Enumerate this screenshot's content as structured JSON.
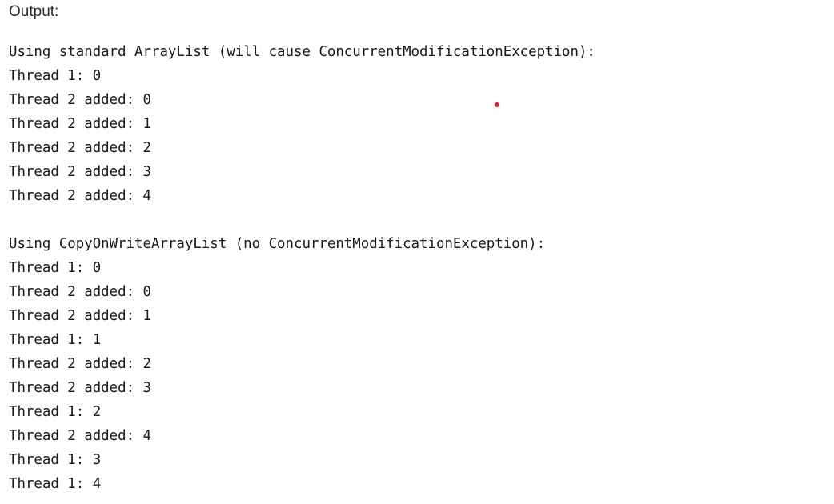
{
  "heading": "Output:",
  "lines": [
    "Using standard ArrayList (will cause ConcurrentModificationException):",
    "Thread 1: 0",
    "Thread 2 added: 0",
    "Thread 2 added: 1",
    "Thread 2 added: 2",
    "Thread 2 added: 3",
    "Thread 2 added: 4",
    "",
    "Using CopyOnWriteArrayList (no ConcurrentModificationException):",
    "Thread 1: 0",
    "Thread 2 added: 0",
    "Thread 2 added: 1",
    "Thread 1: 1",
    "Thread 2 added: 2",
    "Thread 2 added: 3",
    "Thread 1: 2",
    "Thread 2 added: 4",
    "Thread 1: 3",
    "Thread 1: 4"
  ],
  "colors": {
    "dot": "#e0202a"
  }
}
